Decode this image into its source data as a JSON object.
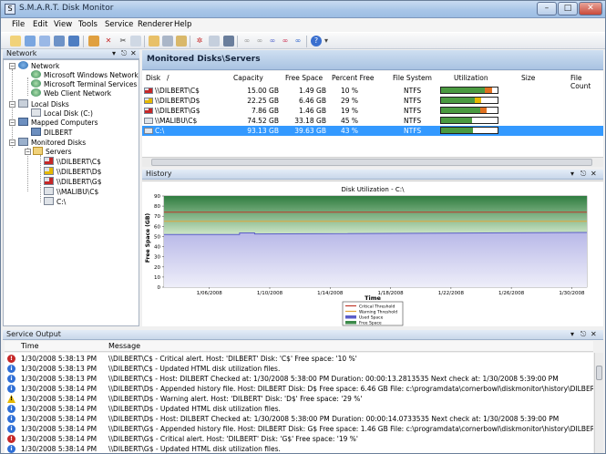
{
  "window": {
    "title": "S.M.A.R.T. Disk Monitor"
  },
  "menu": [
    "File",
    "Edit",
    "View",
    "Tools",
    "Service",
    "Renderer",
    "Help"
  ],
  "network_pane": {
    "title": "Network",
    "tree": {
      "network": "Network",
      "microsoft_windows_network": "Microsoft Windows Network",
      "microsoft_terminal_services": "Microsoft Terminal Services",
      "web_client_network": "Web Client Network",
      "local_disks": "Local Disks",
      "local_disk_c": "Local Disk (C:)",
      "mapped_computers": "Mapped Computers",
      "dilbert": "DILBERT",
      "monitored_disks": "Monitored Disks",
      "servers": "Servers",
      "servers_items": [
        "\\\\DILBERT\\C$",
        "\\\\DILBERT\\D$",
        "\\\\DILBERT\\G$",
        "\\\\MALIBU\\C$",
        "C:\\"
      ]
    }
  },
  "monitored": {
    "title": "Monitored Disks\\Servers",
    "columns": [
      "Disk",
      "/",
      "Capacity",
      "Free Space",
      "Percent Free",
      "File System",
      "Utilization",
      "Size",
      "File Count"
    ],
    "rows": [
      {
        "disk": "\\\\DILBERT\\C$",
        "capacity": "15.00 GB",
        "free": "1.49 GB",
        "percent": "10 %",
        "fs": "NTFS",
        "used_fraction": 0.9,
        "status": "critical"
      },
      {
        "disk": "\\\\DILBERT\\D$",
        "capacity": "22.25 GB",
        "free": "6.46 GB",
        "percent": "29 %",
        "fs": "NTFS",
        "used_fraction": 0.71,
        "status": "warning"
      },
      {
        "disk": "\\\\DILBERT\\G$",
        "capacity": "7.86 GB",
        "free": "1.46 GB",
        "percent": "19 %",
        "fs": "NTFS",
        "used_fraction": 0.81,
        "status": "critical"
      },
      {
        "disk": "\\\\MALIBU\\C$",
        "capacity": "74.52 GB",
        "free": "33.18 GB",
        "percent": "45 %",
        "fs": "NTFS",
        "used_fraction": 0.55,
        "status": "ok"
      },
      {
        "disk": "C:\\",
        "capacity": "93.13 GB",
        "free": "39.63 GB",
        "percent": "43 %",
        "fs": "NTFS",
        "used_fraction": 0.57,
        "status": "ok",
        "selected": true
      }
    ]
  },
  "history": {
    "title": "History"
  },
  "chart_data": {
    "type": "area",
    "title": "Disk Utilization - C:\\",
    "xlabel": "Time",
    "ylabel": "Free Space (GB)",
    "ylim": [
      0,
      90
    ],
    "yticks": [
      0,
      10,
      20,
      30,
      40,
      50,
      60,
      70,
      80,
      90
    ],
    "xticks": [
      "1/06/2008",
      "1/10/2008",
      "1/14/2008",
      "1/18/2008",
      "1/22/2008",
      "1/26/2008",
      "1/30/2008"
    ],
    "xrange": [
      "1/03/2008",
      "1/31/2008"
    ],
    "critical_threshold": 74,
    "warning_threshold": 65,
    "capacity": 93.13,
    "used_space": [
      {
        "x": "1/03/2008",
        "y": 52
      },
      {
        "x": "1/08/2008",
        "y": 52
      },
      {
        "x": "1/08/2008",
        "y": 53.5
      },
      {
        "x": "1/09/2008",
        "y": 53.5
      },
      {
        "x": "1/09/2008",
        "y": 52.5
      },
      {
        "x": "1/31/2008",
        "y": 54
      }
    ],
    "legend": [
      "Critical Threshold",
      "Warning Threshold",
      "Used Space",
      "Free Space"
    ],
    "colors": {
      "critical": "#c0392b",
      "warning": "#e2a63b",
      "used": "#5b5ec9",
      "free": "#3d8b4a"
    }
  },
  "service_output": {
    "title": "Service Output",
    "columns": {
      "time": "Time",
      "message": "Message"
    },
    "rows": [
      {
        "icon": "error",
        "time": "1/30/2008 5:38:13 PM",
        "msg": "\\\\DILBERT\\C$ - Critical alert. Host: 'DILBERT'  Disk: 'C$'  Free space: '10 %'"
      },
      {
        "icon": "info",
        "time": "1/30/2008 5:38:13 PM",
        "msg": "\\\\DILBERT\\C$ - Updated HTML disk utilization files."
      },
      {
        "icon": "info",
        "time": "1/30/2008 5:38:13 PM",
        "msg": "\\\\DILBERT\\C$ - Host: DILBERT  Checked at:  1/30/2008 5:38:00 PM  Duration:  00:00:13.2813535  Next check at:  1/30/2008 5:39:00 PM"
      },
      {
        "icon": "info",
        "time": "1/30/2008 5:38:14 PM",
        "msg": "\\\\DILBERT\\D$ - Appended history file. Host: DILBERT  Disk: D$  Free space: 6.46 GB  File: c:\\programdata\\cornerbowl\\diskmonitor\\history\\DILBERT\\d$.csv"
      },
      {
        "icon": "warning",
        "time": "1/30/2008 5:38:14 PM",
        "msg": "\\\\DILBERT\\D$ - Warning alert. Host: 'DILBERT'  Disk: 'D$'  Free space: '29 %'"
      },
      {
        "icon": "info",
        "time": "1/30/2008 5:38:14 PM",
        "msg": "\\\\DILBERT\\D$ - Updated HTML disk utilization files."
      },
      {
        "icon": "info",
        "time": "1/30/2008 5:38:14 PM",
        "msg": "\\\\DILBERT\\D$ - Host: DILBERT  Checked at:  1/30/2008 5:38:00 PM  Duration:  00:00:14.0733535  Next check at:  1/30/2008 5:39:00 PM"
      },
      {
        "icon": "info",
        "time": "1/30/2008 5:38:14 PM",
        "msg": "\\\\DILBERT\\G$ - Appended history file. Host: DILBERT  Disk: G$  Free space: 1.46 GB  File: c:\\programdata\\cornerbowl\\diskmonitor\\history\\DILBERT\\g$.csv"
      },
      {
        "icon": "error",
        "time": "1/30/2008 5:38:14 PM",
        "msg": "\\\\DILBERT\\G$ - Critical alert. Host: 'DILBERT'  Disk: 'G$'  Free space: '19 %'"
      },
      {
        "icon": "info",
        "time": "1/30/2008 5:38:14 PM",
        "msg": "\\\\DILBERT\\G$ - Updated HTML disk utilization files."
      }
    ]
  },
  "icon_colors": {
    "error": "#c62828",
    "info": "#2f6fd6",
    "warning": "#e6b800"
  }
}
